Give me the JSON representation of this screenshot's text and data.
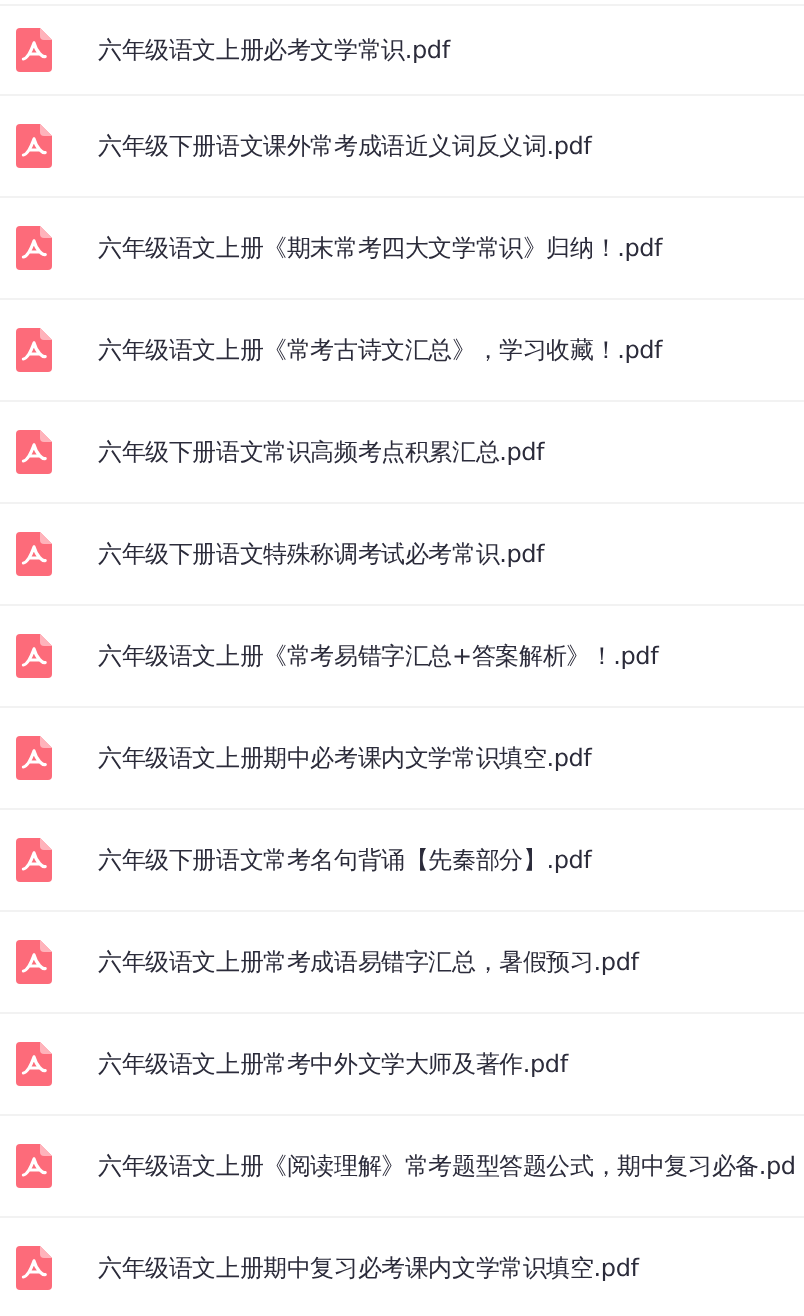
{
  "files": [
    {
      "name": "六年级语文上册必考文学常识.pdf"
    },
    {
      "name": "六年级下册语文课外常考成语近义词反义词.pdf"
    },
    {
      "name": "六年级语文上册《期末常考四大文学常识》归纳！.pdf"
    },
    {
      "name": "六年级语文上册《常考古诗文汇总》，学习收藏！.pdf"
    },
    {
      "name": "六年级下册语文常识高频考点积累汇总.pdf"
    },
    {
      "name": "六年级下册语文特殊称调考试必考常识.pdf"
    },
    {
      "name": "六年级语文上册《常考易错字汇总+答案解析》！.pdf"
    },
    {
      "name": "六年级语文上册期中必考课内文学常识填空.pdf"
    },
    {
      "name": "六年级下册语文常考名句背诵【先秦部分】.pdf"
    },
    {
      "name": "六年级语文上册常考成语易错字汇总，暑假预习.pdf"
    },
    {
      "name": "六年级语文上册常考中外文学大师及著作.pdf"
    },
    {
      "name": "六年级语文上册《阅读理解》常考题型答题公式，期中复习必备.pd"
    },
    {
      "name": "六年级语文上册期中复习必考课内文学常识填空.pdf"
    }
  ]
}
